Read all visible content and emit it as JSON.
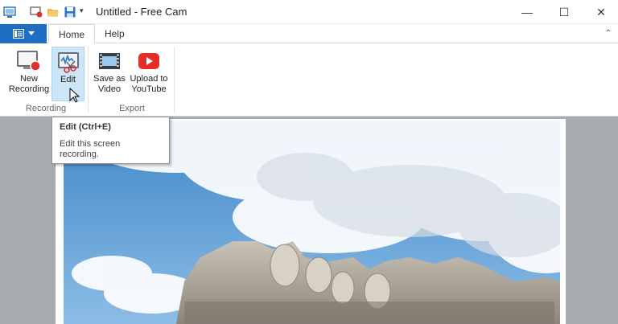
{
  "window": {
    "title": "Untitled - Free Cam",
    "controls": {
      "minimize": "—",
      "maximize": "☐",
      "close": "✕"
    }
  },
  "quick_access": [
    "app-icon",
    "record-icon",
    "folder-open-icon",
    "save-icon",
    "customize-dropdown-icon"
  ],
  "tabs": [
    {
      "label": "Home",
      "active": true
    },
    {
      "label": "Help",
      "active": false
    }
  ],
  "ribbon": {
    "groups": [
      {
        "label": "Recording",
        "buttons": [
          {
            "label": "New\nRecording",
            "icon": "new-recording-icon"
          },
          {
            "label": "Edit",
            "icon": "edit-icon",
            "hovered": true
          }
        ]
      },
      {
        "label": "Export",
        "buttons": [
          {
            "label": "Save as\nVideo",
            "icon": "film-icon"
          },
          {
            "label": "Upload to\nYouTube",
            "icon": "youtube-icon"
          }
        ]
      }
    ]
  },
  "tooltip": {
    "title": "Edit (Ctrl+E)",
    "description": "Edit this screen recording."
  },
  "colors": {
    "accent": "#1e6fc3",
    "hover": "#cde6f7",
    "canvas_bg": "#a8abb0",
    "youtube_red": "#e52d27"
  }
}
